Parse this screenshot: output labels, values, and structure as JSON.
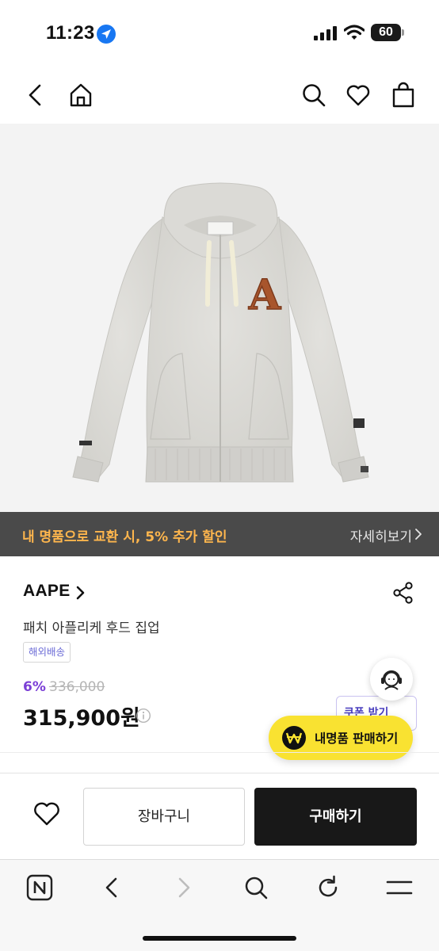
{
  "status_bar": {
    "time": "11:23",
    "battery_level": "60",
    "icons": [
      "location-arrow-icon",
      "signal-icon",
      "wifi-icon",
      "battery-icon"
    ]
  },
  "header": {
    "icons": [
      "back-icon",
      "home-icon",
      "search-icon",
      "heart-icon",
      "shopping-bag-icon"
    ]
  },
  "promo": {
    "text": "내 명품으로 교환 시, 5% 추가 할인",
    "link_label": "자세히보기",
    "text_color": "#ffb64d",
    "background": "#4a4a4a"
  },
  "product": {
    "brand": "AAPE",
    "name": "패치 아플리케 후드 집업",
    "shipping_badge": "해외배송",
    "discount_rate": "6%",
    "original_price": "336,000",
    "price": "315,900원",
    "patch_letter": "A"
  },
  "coupon": {
    "label": "쿠폰 받기"
  },
  "sell_fab": {
    "label": "내명품 판매하기",
    "color": "#f9e231"
  },
  "actions": {
    "cart_label": "장바구니",
    "buy_label": "구매하기",
    "accent": "#181818"
  },
  "browser": {
    "icons": [
      "naver-n-icon",
      "browser-back-icon",
      "browser-forward-icon",
      "browser-search-icon",
      "refresh-icon",
      "menu-icon"
    ]
  }
}
